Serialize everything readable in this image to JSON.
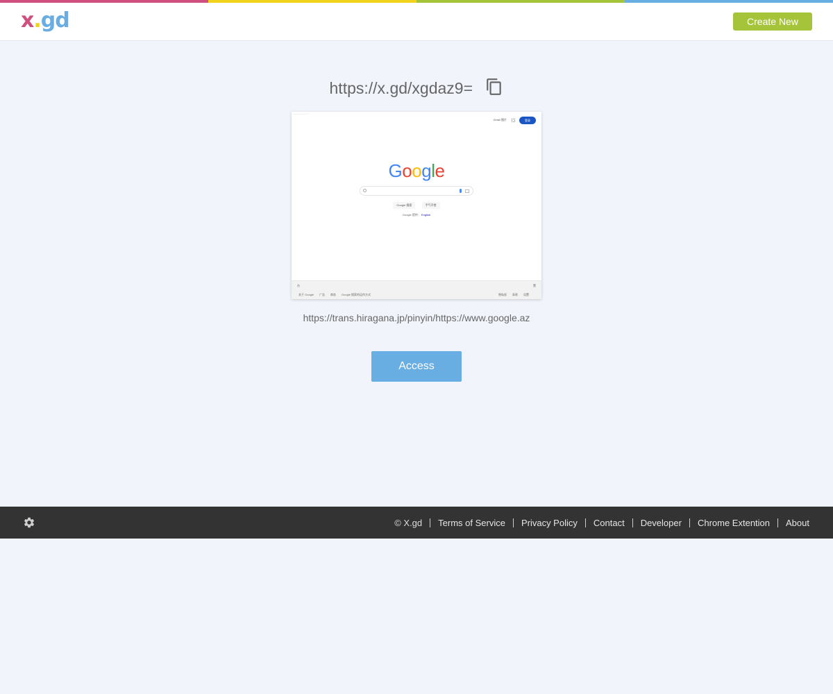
{
  "colors": {
    "bar": [
      "#cf4f7e",
      "#f0d21b",
      "#a6c43a",
      "#68aee3"
    ],
    "create_btn": "#a6c43a",
    "access_btn": "#68aee3",
    "logo_x": "#cf4f7e",
    "logo_dot": "#f0d21b",
    "logo_gd": "#68aee3",
    "footer_bg": "#333333",
    "page_bg": "#f1f5fb"
  },
  "header": {
    "logo": {
      "x": "x",
      "dot": ".",
      "gd": "gd"
    },
    "create_label": "Create New"
  },
  "main": {
    "short_url": "https://x.gd/xgdaz9=",
    "copy_icon": "copy-icon",
    "long_url": "https://trans.hiragana.jp/pinyin/https://www.google.az",
    "access_label": "Access",
    "preview": {
      "logo": "Google",
      "btn1": "Google 搜索",
      "btn2": "手气不错",
      "lang_prefix": "Google 提供：",
      "lang_link": "English"
    }
  },
  "footer": {
    "settings_icon": "gear-icon",
    "copyright": "© X.gd",
    "links": [
      "Terms of Service",
      "Privacy Policy",
      "Contact",
      "Developer",
      "Chrome Extention",
      "About"
    ]
  }
}
